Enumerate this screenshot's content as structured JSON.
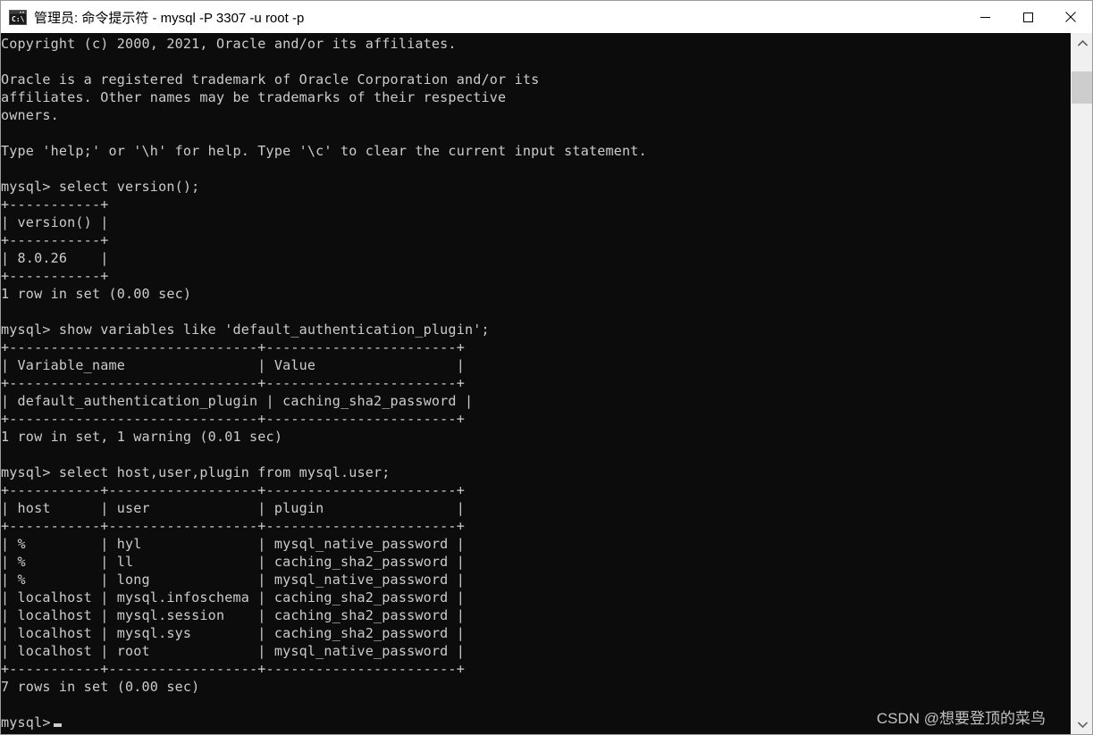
{
  "window": {
    "title": "管理员: 命令提示符 - mysql  -P 3307 -u root -p",
    "icon": "cmd-console-icon",
    "background": "#0c0c0c",
    "text_color": "#cccccc",
    "titlebar_background": "#ffffff"
  },
  "controls": {
    "minimize_label": "─",
    "maximize_label": "☐",
    "close_label": "✕"
  },
  "scrollbar": {
    "up_arrow": "⌃",
    "down_arrow": "⌄",
    "thumb_position_pct": 3
  },
  "console": {
    "lines": [
      "Copyright (c) 2000, 2021, Oracle and/or its affiliates.",
      "",
      "Oracle is a registered trademark of Oracle Corporation and/or its",
      "affiliates. Other names may be trademarks of their respective",
      "owners.",
      "",
      "Type 'help;' or '\\h' for help. Type '\\c' to clear the current input statement.",
      "",
      "mysql> select version();",
      "+-----------+",
      "| version() |",
      "+-----------+",
      "| 8.0.26    |",
      "+-----------+",
      "1 row in set (0.00 sec)",
      "",
      "mysql> show variables like 'default_authentication_plugin';",
      "+------------------------------+-----------------------+",
      "| Variable_name                | Value                 |",
      "+------------------------------+-----------------------+",
      "| default_authentication_plugin | caching_sha2_password |",
      "+------------------------------+-----------------------+",
      "1 row in set, 1 warning (0.01 sec)",
      "",
      "mysql> select host,user,plugin from mysql.user;",
      "+-----------+------------------+-----------------------+",
      "| host      | user             | plugin                |",
      "+-----------+------------------+-----------------------+",
      "| %         | hyl              | mysql_native_password |",
      "| %         | ll               | caching_sha2_password |",
      "| %         | long             | mysql_native_password |",
      "| localhost | mysql.infoschema | caching_sha2_password |",
      "| localhost | mysql.session    | caching_sha2_password |",
      "| localhost | mysql.sys        | caching_sha2_password |",
      "| localhost | root             | mysql_native_password |",
      "+-----------+------------------+-----------------------+",
      "7 rows in set (0.00 sec)",
      ""
    ],
    "prompt": "mysql>",
    "queries": [
      {
        "command": "select version();",
        "columns": [
          "version()"
        ],
        "rows": [
          [
            "8.0.26"
          ]
        ],
        "status": "1 row in set (0.00 sec)"
      },
      {
        "command": "show variables like 'default_authentication_plugin';",
        "columns": [
          "Variable_name",
          "Value"
        ],
        "rows": [
          [
            "default_authentication_plugin",
            "caching_sha2_password"
          ]
        ],
        "status": "1 row in set, 1 warning (0.01 sec)"
      },
      {
        "command": "select host,user,plugin from mysql.user;",
        "columns": [
          "host",
          "user",
          "plugin"
        ],
        "rows": [
          [
            "%",
            "hyl",
            "mysql_native_password"
          ],
          [
            "%",
            "ll",
            "caching_sha2_password"
          ],
          [
            "%",
            "long",
            "mysql_native_password"
          ],
          [
            "localhost",
            "mysql.infoschema",
            "caching_sha2_password"
          ],
          [
            "localhost",
            "mysql.session",
            "caching_sha2_password"
          ],
          [
            "localhost",
            "mysql.sys",
            "caching_sha2_password"
          ],
          [
            "localhost",
            "root",
            "mysql_native_password"
          ]
        ],
        "status": "7 rows in set (0.00 sec)"
      }
    ]
  },
  "watermark": {
    "text": "CSDN @想要登顶的菜鸟"
  }
}
